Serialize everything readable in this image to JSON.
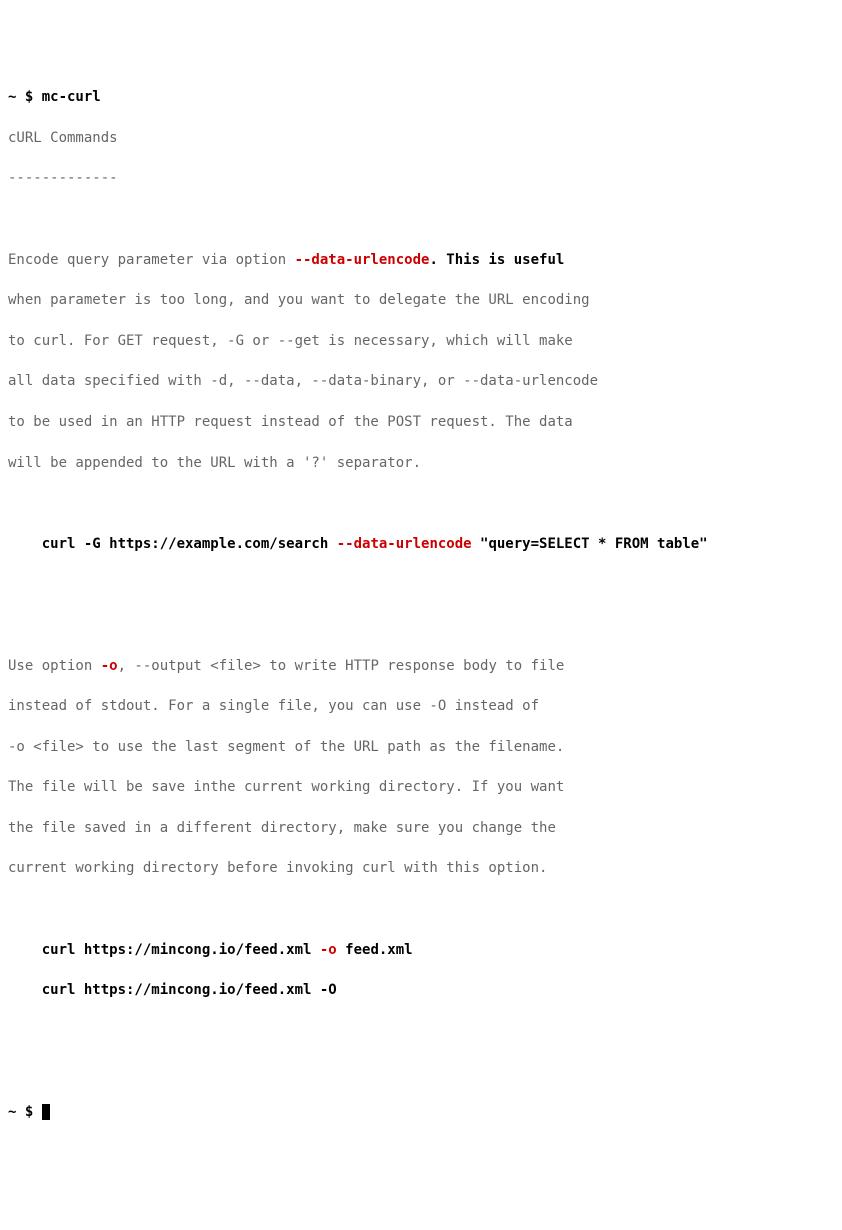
{
  "prompt1": {
    "ps": "~ $ ",
    "cmd": "mc-curl"
  },
  "title": "cURL Commands",
  "rule": "-------------",
  "p1": {
    "a": "Encode query parameter via option ",
    "opt": "--data-urlencode",
    "b": ". This is useful",
    "l2": "when parameter is too long, and you want to delegate the URL encoding",
    "l3": "to curl. For GET request, -G or --get is necessary, which will make",
    "l4": "all data specified with -d, --data, --data-binary, or --data-urlencode",
    "l5": "to be used in an HTTP request instead of the POST request. The data",
    "l6": "will be appended to the URL with a '?' separator."
  },
  "ex1": {
    "pre": "    curl -G https://example.com/search ",
    "opt": "--data-urlencode",
    "post": " \"query=SELECT * FROM table\""
  },
  "p2": {
    "a": "Use option ",
    "opt": "-o",
    "b": ", --output <file> to write HTTP response body to file",
    "l2": "instead of stdout. For a single file, you can use -O instead of",
    "l3": "-o <file> to use the last segment of the URL path as the filename.",
    "l4": "The file will be save inthe current working directory. If you want",
    "l5": "the file saved in a different directory, make sure you change the",
    "l6": "current working directory before invoking curl with this option."
  },
  "ex2": {
    "a_pre": "    curl https://mincong.io/feed.xml ",
    "a_opt": "-o",
    "a_post": " feed.xml",
    "b": "    curl https://mincong.io/feed.xml -O"
  },
  "prompt2": {
    "ps": "~ $ "
  }
}
